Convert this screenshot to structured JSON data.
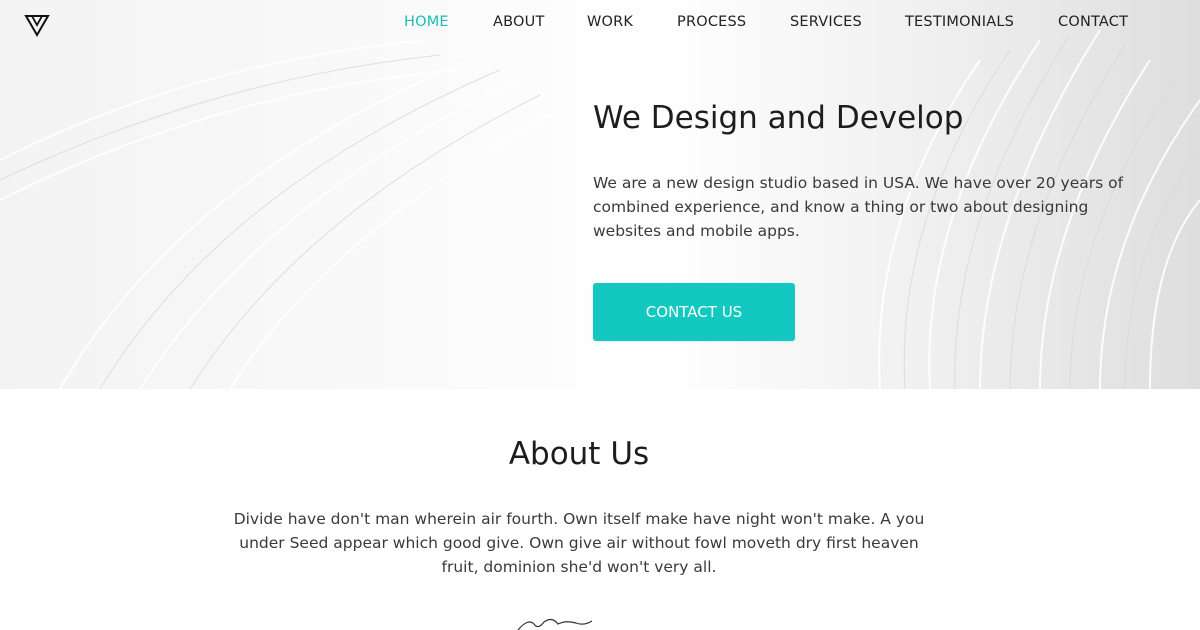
{
  "colors": {
    "accent": "#19bdb5",
    "button": "#13c8c0",
    "text": "#222222"
  },
  "nav": {
    "logo_icon": "triangle-logo-icon",
    "items": [
      {
        "label": "HOME",
        "active": true
      },
      {
        "label": "ABOUT",
        "active": false
      },
      {
        "label": "WORK",
        "active": false
      },
      {
        "label": "PROCESS",
        "active": false
      },
      {
        "label": "SERVICES",
        "active": false
      },
      {
        "label": "TESTIMONIALS",
        "active": false
      },
      {
        "label": "CONTACT",
        "active": false
      }
    ]
  },
  "hero": {
    "title": "We Design and Develop",
    "text": "We are a new design studio based in USA. We have over 20 years of combined experience, and know a thing or two about designing websites and mobile apps.",
    "cta_label": "CONTACT US"
  },
  "about": {
    "title": "About Us",
    "text": "Divide have don't man wherein air fourth. Own itself make have night won't make. A you under Seed appear which good give. Own give air without fowl moveth dry first heaven fruit, dominion she'd won't very all."
  }
}
